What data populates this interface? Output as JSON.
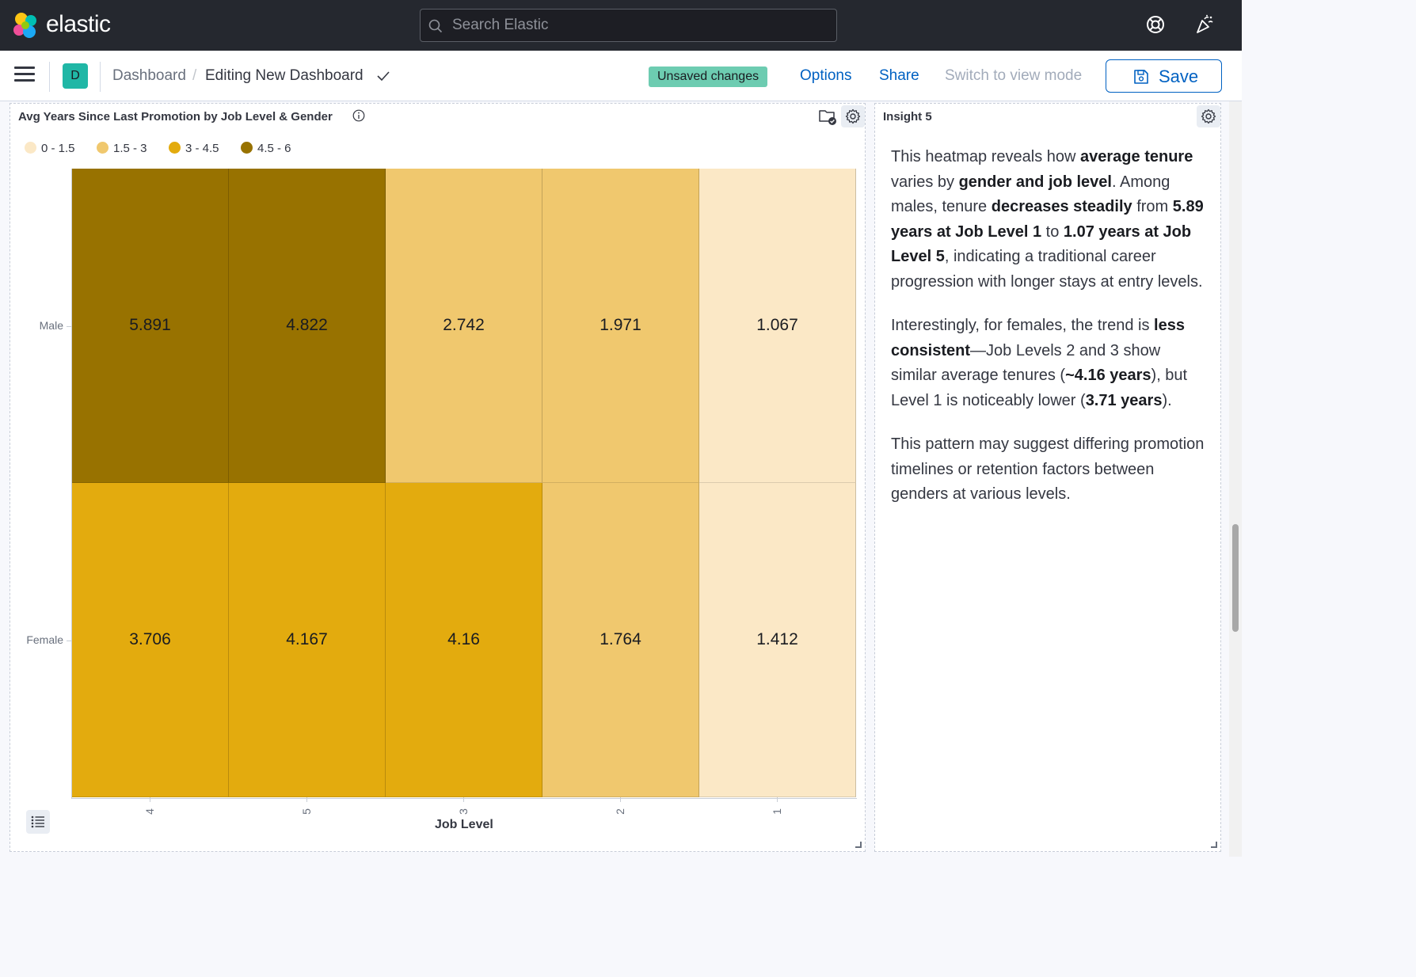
{
  "app": {
    "brand": "elastic",
    "search_placeholder": "Search Elastic"
  },
  "header": {
    "space_initial": "D",
    "breadcrumb_root": "Dashboard",
    "breadcrumb_current": "Editing New Dashboard",
    "unsaved_badge": "Unsaved changes",
    "options_label": "Options",
    "share_label": "Share",
    "view_mode_label": "Switch to view mode",
    "save_label": "Save"
  },
  "chart_panel": {
    "title": "Avg Years Since Last Promotion by Job Level & Gender"
  },
  "chart_data": {
    "type": "heatmap",
    "title": "Avg Years Since Last Promotion by Job Level & Gender",
    "xlabel": "Job Level",
    "ylabel": "",
    "x": [
      "4",
      "5",
      "3",
      "2",
      "1"
    ],
    "y": [
      "Male",
      "Female"
    ],
    "values": [
      [
        5.891,
        4.822,
        2.742,
        1.971,
        1.067
      ],
      [
        3.706,
        4.167,
        4.16,
        1.764,
        1.412
      ]
    ],
    "legend": [
      {
        "label": "0 - 1.5",
        "color": "#fbe8c6",
        "min": 0,
        "max": 1.5
      },
      {
        "label": "1.5 - 3",
        "color": "#f0c86e",
        "min": 1.5,
        "max": 3
      },
      {
        "label": "3 - 4.5",
        "color": "#e3ab0e",
        "min": 3,
        "max": 4.5
      },
      {
        "label": "4.5 - 6",
        "color": "#987200",
        "min": 4.5,
        "max": 6
      }
    ],
    "legend_position": "top-left"
  },
  "insight_panel": {
    "title": "Insight 5",
    "paragraphs": [
      [
        {
          "t": "This heatmap reveals how "
        },
        {
          "t": "average tenure",
          "b": true
        },
        {
          "t": " varies by "
        },
        {
          "t": "gender and job level",
          "b": true
        },
        {
          "t": ". Among males, tenure "
        },
        {
          "t": "decreases steadily",
          "b": true
        },
        {
          "t": " from "
        },
        {
          "t": "5.89 years at Job Level 1",
          "b": true
        },
        {
          "t": " to "
        },
        {
          "t": "1.07 years at Job Level 5",
          "b": true
        },
        {
          "t": ", indicating a traditional career progression with longer stays at entry levels."
        }
      ],
      [
        {
          "t": "Interestingly, for females, the trend is "
        },
        {
          "t": "less consistent",
          "b": true
        },
        {
          "t": "—Job Levels 2 and 3 show similar average tenures ("
        },
        {
          "t": "~4.16 years",
          "b": true
        },
        {
          "t": "), but Level 1 is noticeably lower ("
        },
        {
          "t": "3.71 years",
          "b": true
        },
        {
          "t": ")."
        }
      ],
      [
        {
          "t": "This pattern may suggest differing promotion timelines or retention factors between genders at various levels."
        }
      ]
    ]
  }
}
